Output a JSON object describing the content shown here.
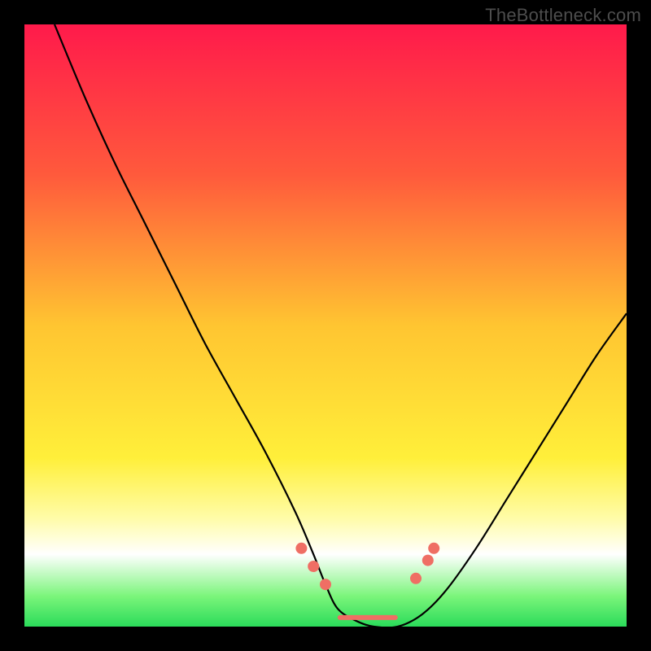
{
  "attribution": "TheBottleneck.com",
  "chart_data": {
    "type": "line",
    "title": "",
    "xlabel": "",
    "ylabel": "",
    "xlim": [
      0,
      100
    ],
    "ylim": [
      0,
      100
    ],
    "gradient_stops": [
      {
        "offset": 0,
        "color": "#ff1a4b"
      },
      {
        "offset": 25,
        "color": "#ff5a3c"
      },
      {
        "offset": 50,
        "color": "#ffc531"
      },
      {
        "offset": 72,
        "color": "#ffef3a"
      },
      {
        "offset": 82,
        "color": "#fffca8"
      },
      {
        "offset": 88,
        "color": "#ffffff"
      },
      {
        "offset": 95,
        "color": "#7af57a"
      },
      {
        "offset": 100,
        "color": "#2bdb5a"
      }
    ],
    "series": [
      {
        "name": "bottleneck-curve",
        "x": [
          5,
          10,
          15,
          20,
          25,
          30,
          35,
          40,
          45,
          48,
          50,
          52,
          55,
          58,
          62,
          66,
          70,
          75,
          80,
          85,
          90,
          95,
          100
        ],
        "y": [
          100,
          88,
          77,
          67,
          57,
          47,
          38,
          29,
          19,
          12,
          7,
          3,
          1,
          0,
          0,
          2,
          6,
          13,
          21,
          29,
          37,
          45,
          52
        ]
      }
    ],
    "markers": {
      "name": "highlight-dots",
      "color": "#ef6e64",
      "points": [
        {
          "x": 46,
          "y": 13
        },
        {
          "x": 48,
          "y": 10
        },
        {
          "x": 50,
          "y": 7
        },
        {
          "x": 65,
          "y": 8
        },
        {
          "x": 67,
          "y": 11
        },
        {
          "x": 68,
          "y": 13
        }
      ]
    },
    "flat_band": {
      "name": "valley-floor",
      "color": "#ef6e64",
      "x0": 52,
      "x1": 62,
      "y": 1.5,
      "thickness": 6
    }
  }
}
